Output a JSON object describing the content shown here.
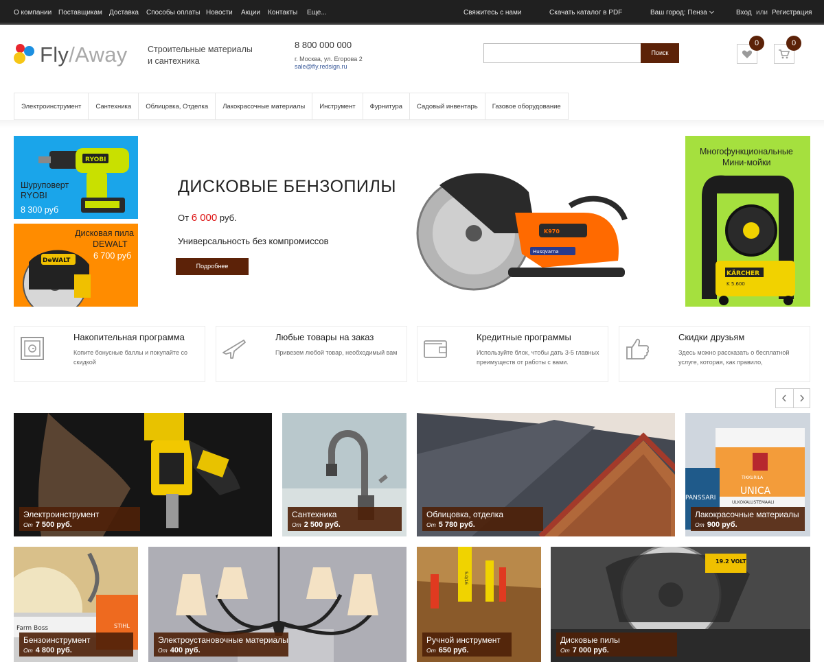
{
  "topbar": {
    "links": [
      "О компании",
      "Поставщикам",
      "Доставка",
      "Способы оплаты",
      "Новости",
      "Акции",
      "Контакты",
      "Еще..."
    ],
    "contact": "Свяжитесь с нами",
    "catalog": "Скачать каталог в PDF",
    "city": "Ваш город: Пенза",
    "login": "Вход",
    "or": "или",
    "register": "Регистрация"
  },
  "header": {
    "logo_fly": "Fly",
    "logo_slash": "/",
    "logo_away": "Away",
    "tagline_1": "Строительные материалы",
    "tagline_2": "и сантехника",
    "phone": "8 800 000 000",
    "address": "г. Москва, ул. Егорова 2",
    "email": "sale@fly.redsign.ru",
    "search_placeholder": "",
    "search_button": "Поиск",
    "favorites_count": "0",
    "cart_count": "0"
  },
  "nav": [
    "Электроинструмент",
    "Сантехника",
    "Облицовка, Отделка",
    "Лакокрасочные материалы",
    "Инструмент",
    "Фурнитура",
    "Садовый инвентарь",
    "Газовое оборудование"
  ],
  "banners": {
    "left1": {
      "line1": "Шуруповерт",
      "line2": "RYOBI",
      "line3": "8 300 руб"
    },
    "left2": {
      "line1": "Дисковая пила",
      "line2": "DEWALT",
      "line3": "6 700 руб"
    },
    "right": {
      "line1": "Многофункциональные",
      "line2": "Мини-мойки"
    },
    "hero": {
      "title": "ДИСКОВЫЕ БЕНЗОПИЛЫ",
      "price_prefix": "От",
      "price_value": "6 000",
      "price_suffix": "руб.",
      "subtitle": "Универсальность без компромиссов",
      "button": "Подробнее"
    }
  },
  "features": [
    {
      "title": "Накопительная программа",
      "desc": "Копите бонусные баллы и покупайте со скидкой",
      "icon": "safe-icon"
    },
    {
      "title": "Любые товары на заказ",
      "desc": "Привезем любой товар, необходимый вам",
      "icon": "airplane-icon"
    },
    {
      "title": "Кредитные программы",
      "desc": "Используйте блок, чтобы дать 3-5 главных преимуществ от работы с вами.",
      "icon": "wallet-icon"
    },
    {
      "title": "Скидки друзьям",
      "desc": "Здесь можно рассказать о бесплатной услуге, которая, как правило,",
      "icon": "thumbs-up-icon"
    }
  ],
  "categories": [
    {
      "name": "Электроинструмент",
      "from": "От",
      "price": "7 500 руб."
    },
    {
      "name": "Сантехника",
      "from": "От",
      "price": "2 500 руб."
    },
    {
      "name": "Облицовка, отделка",
      "from": "От",
      "price": "5 780 руб."
    },
    {
      "name": "Лакокрасочные материалы",
      "from": "От",
      "price": "900 руб."
    },
    {
      "name": "Бензоинструмент",
      "from": "От",
      "price": "4 800 руб."
    },
    {
      "name": "Электроустановочные материалы",
      "from": "От",
      "price": "400 руб."
    },
    {
      "name": "Ручной инструмент",
      "from": "От",
      "price": "650 руб."
    },
    {
      "name": "Дисковые пилы",
      "from": "От",
      "price": "7 000 руб."
    }
  ],
  "image_labels": {
    "ryobi_brand": "RYOBI",
    "dewalt_brand": "DeWALT",
    "saw_brand": "Husqvarna",
    "saw_model": "K970",
    "karcher_brand": "KÄRCHER",
    "karcher_model": "K 5.600",
    "paint_brand": "TIKKURILA",
    "paint_name": "UNICA",
    "paint_sub": "ULKOKALUSTEMAALI",
    "paint_other": "PANSSARI",
    "chainsaw_brand": "Farm Boss",
    "chainsaw_maker": "STIHL",
    "tape_text": "5.0/16",
    "voltage": "19.2 VOLT"
  },
  "colors": {
    "topbar": "#202020",
    "accent": "#5c2208",
    "price_red": "#dd1111",
    "banner_blue": "#1aa5ea",
    "banner_orange": "#ff8c00",
    "banner_green": "#a5e03e"
  }
}
